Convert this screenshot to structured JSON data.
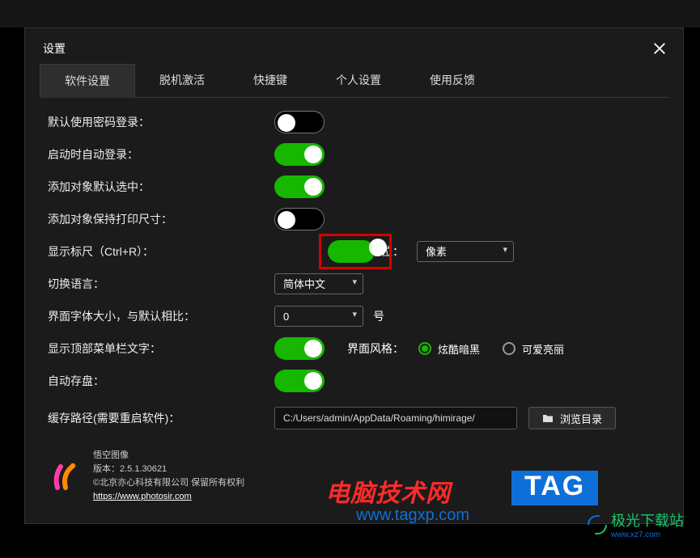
{
  "dialog": {
    "title": "设置"
  },
  "tabs": {
    "software": "软件设置",
    "offline": "脱机激活",
    "shortcut": "快捷键",
    "personal": "个人设置",
    "feedback": "使用反馈"
  },
  "labels": {
    "default_pwd_login": "默认使用密码登录：",
    "auto_login": "启动时自动登录：",
    "add_obj_default_select": "添加对象默认选中：",
    "add_obj_keep_print_size": "添加对象保持打印尺寸：",
    "show_ruler": "显示标尺（Ctrl+R）：",
    "unit": "单位：",
    "switch_lang": "切换语言：",
    "ui_font_size": "界面字体大小，与默认相比：",
    "font_unit": "号",
    "show_top_menu_text": "显示顶部菜单栏文字：",
    "ui_style": "界面风格：",
    "auto_save": "自动存盘：",
    "cache_path": "缓存路径(需要重启软件)：",
    "browse": "浏览目录"
  },
  "values": {
    "unit_select": "像素",
    "lang_select": "简体中文",
    "font_size_select": "0",
    "cache_path": "C:/Users/admin/AppData/Roaming/himirage/"
  },
  "style_options": {
    "dark": "炫酷暗黑",
    "light": "可爱亮丽"
  },
  "footer": {
    "app_name": "悟空图像",
    "version": "版本：2.5.1.30621",
    "copyright": "©北京亦心科技有限公司 保留所有权利",
    "url": "https://www.photosir.com"
  },
  "watermarks": {
    "wm1": "电脑技术网",
    "wm2": "TAG",
    "wm3": "www.tagxp.com",
    "wm4": "极光下载站",
    "wm4_sub": "www.xz7.com"
  }
}
